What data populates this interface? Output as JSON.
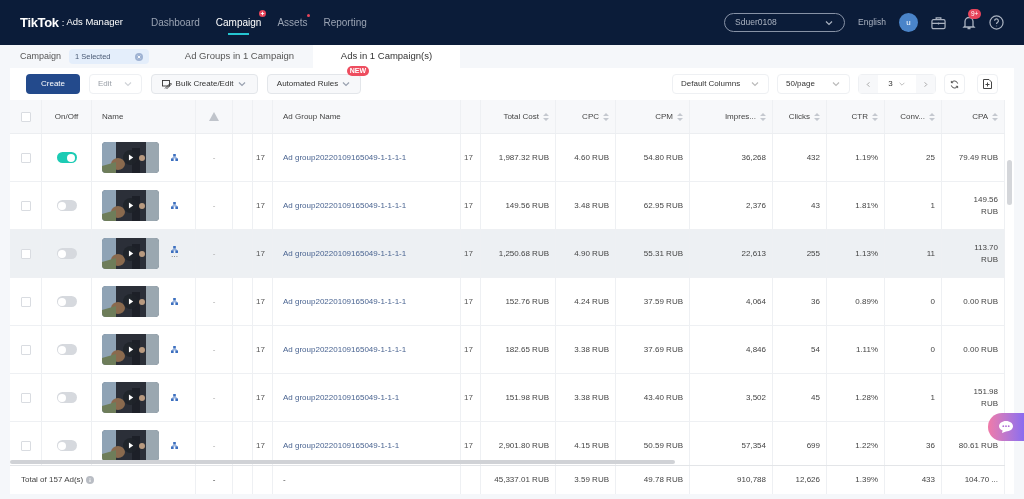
{
  "header": {
    "logo": "TikTok",
    "logo_separator": ":",
    "logo_suffix": "Ads Manager",
    "nav": [
      {
        "label": "Dashboard",
        "selected": false,
        "plus_badge": false,
        "dot_badge": false
      },
      {
        "label": "Campaign",
        "selected": true,
        "plus_badge": true,
        "dot_badge": false
      },
      {
        "label": "Assets",
        "selected": false,
        "plus_badge": false,
        "dot_badge": true
      },
      {
        "label": "Reporting",
        "selected": false,
        "plus_badge": false,
        "dot_badge": false
      }
    ],
    "account": "Sduer0108",
    "language": "English",
    "avatar": "u",
    "notifications": "9+"
  },
  "level_tabs": [
    {
      "kind": "filter",
      "label": "Campaign",
      "chip": "1 Selected",
      "selected": false
    },
    {
      "kind": "tab",
      "label": "Ad Groups in 1 Campaign",
      "selected": false
    },
    {
      "kind": "tab",
      "label": "Ads in 1 Campaign(s)",
      "selected": true
    }
  ],
  "toolbar": {
    "create": "Create",
    "edit": {
      "label": "Edit",
      "disabled": true
    },
    "bulk": "Bulk Create/Edit",
    "rules": "Automated Rules",
    "rules_badge": "NEW",
    "columns": "Default Columns",
    "page_size": "50/page",
    "page": "3"
  },
  "table": {
    "select_all_checked": false,
    "columns": [
      "On/Off",
      "Name",
      "Ad Group Name",
      "Total Cost",
      "CPC",
      "CPM",
      "Impres...",
      "Clicks",
      "CTR",
      "Conv...",
      "CPA"
    ],
    "rows": [
      {
        "checked": false,
        "on": true,
        "highlighted": false,
        "column_4": "-",
        "column_6": "17",
        "ad_group": "Ad group20220109165049-1-1-1-1",
        "column_8": "17",
        "cost": "1,987.32 RUB",
        "cpc": "4.60 RUB",
        "cpm": "54.80 RUB",
        "impressions": "36,268",
        "clicks": "432",
        "ctr": "1.19%",
        "conv": "25",
        "cpa": "79.49 RUB"
      },
      {
        "checked": false,
        "on": false,
        "highlighted": false,
        "column_4": "-",
        "column_6": "17",
        "ad_group": "Ad group20220109165049-1-1-1-1",
        "column_8": "17",
        "cost": "149.56 RUB",
        "cpc": "3.48 RUB",
        "cpm": "62.95 RUB",
        "impressions": "2,376",
        "clicks": "43",
        "ctr": "1.81%",
        "conv": "1",
        "cpa": "149.56 RUB"
      },
      {
        "checked": false,
        "on": false,
        "highlighted": true,
        "more": "···",
        "column_4": "-",
        "column_6": "17",
        "ad_group": "Ad group20220109165049-1-1-1-1",
        "column_8": "17",
        "cost": "1,250.68 RUB",
        "cpc": "4.90 RUB",
        "cpm": "55.31 RUB",
        "impressions": "22,613",
        "clicks": "255",
        "ctr": "1.13%",
        "conv": "11",
        "cpa": "113.70 RUB"
      },
      {
        "checked": false,
        "on": false,
        "highlighted": false,
        "column_4": "-",
        "column_6": "17",
        "ad_group": "Ad group20220109165049-1-1-1-1",
        "column_8": "17",
        "cost": "152.76 RUB",
        "cpc": "4.24 RUB",
        "cpm": "37.59 RUB",
        "impressions": "4,064",
        "clicks": "36",
        "ctr": "0.89%",
        "conv": "0",
        "cpa": "0.00 RUB"
      },
      {
        "checked": false,
        "on": false,
        "highlighted": false,
        "column_4": "-",
        "column_6": "17",
        "ad_group": "Ad group20220109165049-1-1-1-1",
        "column_8": "17",
        "cost": "182.65 RUB",
        "cpc": "3.38 RUB",
        "cpm": "37.69 RUB",
        "impressions": "4,846",
        "clicks": "54",
        "ctr": "1.11%",
        "conv": "0",
        "cpa": "0.00 RUB"
      },
      {
        "checked": false,
        "on": false,
        "highlighted": false,
        "column_4": "-",
        "column_6": "17",
        "ad_group": "Ad group20220109165049-1-1-1",
        "column_8": "17",
        "cost": "151.98 RUB",
        "cpc": "3.38 RUB",
        "cpm": "43.40 RUB",
        "impressions": "3,502",
        "clicks": "45",
        "ctr": "1.28%",
        "conv": "1",
        "cpa": "151.98 RUB"
      },
      {
        "checked": false,
        "on": false,
        "highlighted": false,
        "column_4": "-",
        "column_6": "17",
        "ad_group": "Ad group20220109165049-1-1-1",
        "column_8": "17",
        "cost": "2,901.80 RUB",
        "cpc": "4.15 RUB",
        "cpm": "50.59 RUB",
        "impressions": "57,354",
        "clicks": "699",
        "ctr": "1.22%",
        "conv": "36",
        "cpa": "80.61 RUB"
      }
    ],
    "total": {
      "label": "Total of 157 Ad(s)",
      "column_4": "-",
      "ad_group": "-",
      "cost": "45,337.01 RUB",
      "cpc": "3.59 RUB",
      "cpm": "49.78 RUB",
      "impressions": "910,788",
      "clicks": "12,626",
      "ctr": "1.39%",
      "conv": "433",
      "cpa": "104.70 ..."
    }
  }
}
